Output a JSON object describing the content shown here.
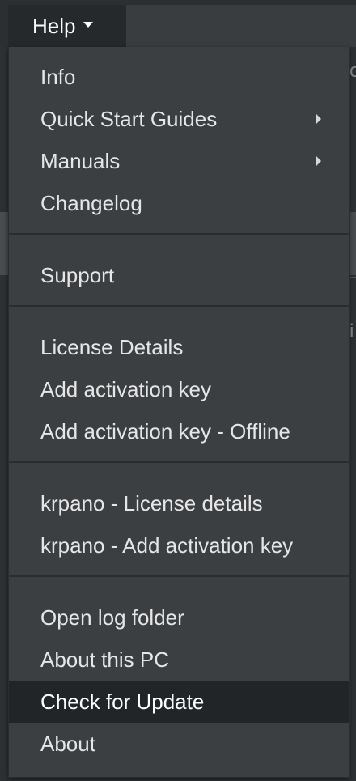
{
  "menubar": {
    "help_label": "Help"
  },
  "help_menu": {
    "groups": [
      [
        {
          "label": "Info",
          "has_submenu": false
        },
        {
          "label": "Quick Start Guides",
          "has_submenu": true
        },
        {
          "label": "Manuals",
          "has_submenu": true
        },
        {
          "label": "Changelog",
          "has_submenu": false
        }
      ],
      [
        {
          "label": "Support",
          "has_submenu": false
        }
      ],
      [
        {
          "label": "License Details",
          "has_submenu": false
        },
        {
          "label": "Add activation key",
          "has_submenu": false
        },
        {
          "label": "Add activation key - Offline",
          "has_submenu": false
        }
      ],
      [
        {
          "label": "krpano - License details",
          "has_submenu": false
        },
        {
          "label": "krpano - Add activation key",
          "has_submenu": false
        }
      ],
      [
        {
          "label": "Open log folder",
          "has_submenu": false
        },
        {
          "label": "About this PC",
          "has_submenu": false
        },
        {
          "label": "Check for Update",
          "has_submenu": false,
          "highlighted": true
        },
        {
          "label": "About",
          "has_submenu": false
        }
      ]
    ]
  },
  "colors": {
    "menu_background": "#3c3f42",
    "menu_text": "#e6e6e6",
    "highlight_background": "#222528",
    "divider": "#2a2d30"
  }
}
